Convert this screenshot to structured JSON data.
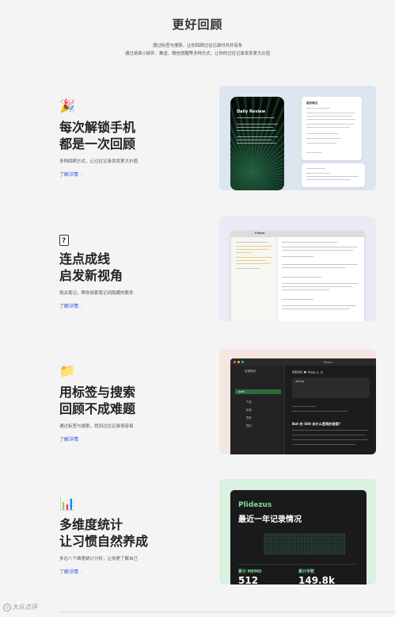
{
  "header": {
    "title": "更好回顾",
    "subtitle1": "通过标签与搜索，让你回顾过往记录时井井有条",
    "subtitle2": "通过桌面小部件、推送、微信提醒等多种方式，让你的过往记录发挥更大价值"
  },
  "features": [
    {
      "icon": "party-popper-icon",
      "emoji": "🎉",
      "title_line1": "每次解锁手机",
      "title_line2": "都是一次回顾",
      "desc": "多种回顾方式，让过往记录发挥更大价值",
      "more": "了解详情",
      "arrow": "›"
    },
    {
      "icon": "question-box-icon",
      "title_line1": "连点成线",
      "title_line2": "启发新视角",
      "desc": "相关笔记，帮你探索笔记间隐藏的联系",
      "more": "了解详情",
      "arrow": "›"
    },
    {
      "icon": "folder-icon",
      "emoji": "📁",
      "title_line1": "用标签与搜索",
      "title_line2": "回顾不成难题",
      "desc": "通过标签与搜索，找到过往记录很容易",
      "more": "了解详情",
      "arrow": "›"
    },
    {
      "icon": "bar-chart-icon",
      "emoji": "📊",
      "title_line1": "多维度统计",
      "title_line2": "让习惯自然养成",
      "desc": "多达八个维度统计分析，让你更了解自己",
      "more": "了解详情",
      "arrow": "›"
    }
  ],
  "cards": {
    "widget": {
      "phone_title": "Daily Review",
      "panel_title": "相关笔记"
    },
    "related": {
      "app_name": "Flomo"
    },
    "tags": {
      "window_title": "flomo",
      "sidebar_head": "全部笔记",
      "items": [
        "Area",
        "产品",
        "阅读",
        "思考",
        "提问"
      ],
      "main_head": "MEMO ♥ Area ∠ ⊙",
      "box_label": "#Area",
      "question": "Bet 的 500 米什么是我的答案？"
    },
    "stats": {
      "brand": "Plidezus",
      "subtitle": "最近一年记录情况",
      "label1": "累计 MEMO",
      "value1": "512",
      "label2": "累计字数",
      "value2": "149.8k"
    }
  },
  "footer": {
    "watermark": "大众点评"
  }
}
